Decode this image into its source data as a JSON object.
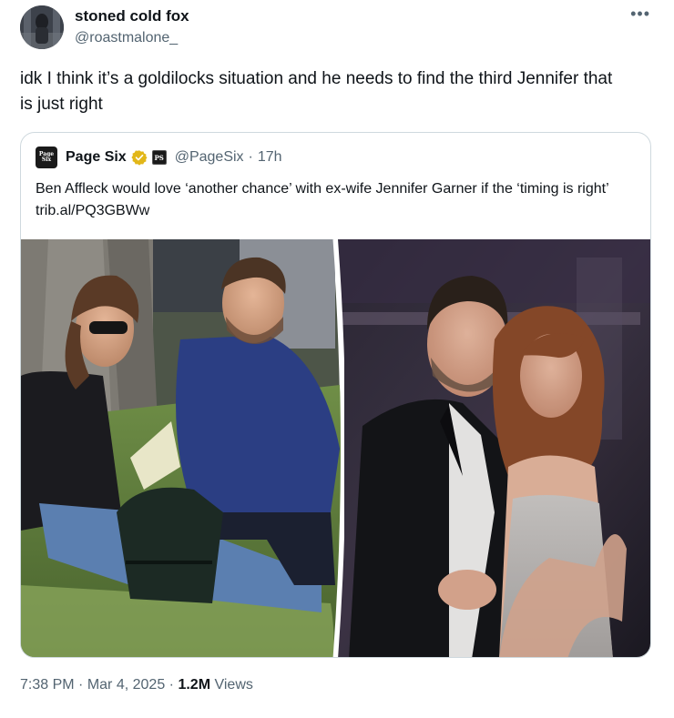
{
  "author": {
    "display_name": "stoned cold fox",
    "handle": "@roastmalone_",
    "avatar_icon": "avatar-icon"
  },
  "more_icon": "more-options-icon",
  "tweet": {
    "text": "idk I think it’s a goldilocks situation and he needs to find the third Jennifer that is just right"
  },
  "quote": {
    "logo_text_line1": "Page",
    "logo_text_line2": "Six",
    "name": "Page Six",
    "verified_icon": "verified-gold-icon",
    "affiliate_text": "PS",
    "handle": "@PageSix",
    "separator": "·",
    "time": "17h",
    "text": "Ben Affleck would love ‘another chance’ with ex-wife Jennifer Garner if the ‘timing is right’ trib.al/PQ3GBWw"
  },
  "media": {
    "left_photo": "couple-in-park-photo",
    "right_photo": "couple-at-event-photo"
  },
  "meta": {
    "time": "7:38 PM",
    "sep1": "·",
    "date": "Mar 4, 2025",
    "sep2": "·",
    "views_count": "1.2M",
    "views_label": "Views"
  },
  "colors": {
    "text_primary": "#0f1419",
    "text_secondary": "#536471",
    "border": "#cfd9de",
    "verified_gold": "#e2b719"
  }
}
